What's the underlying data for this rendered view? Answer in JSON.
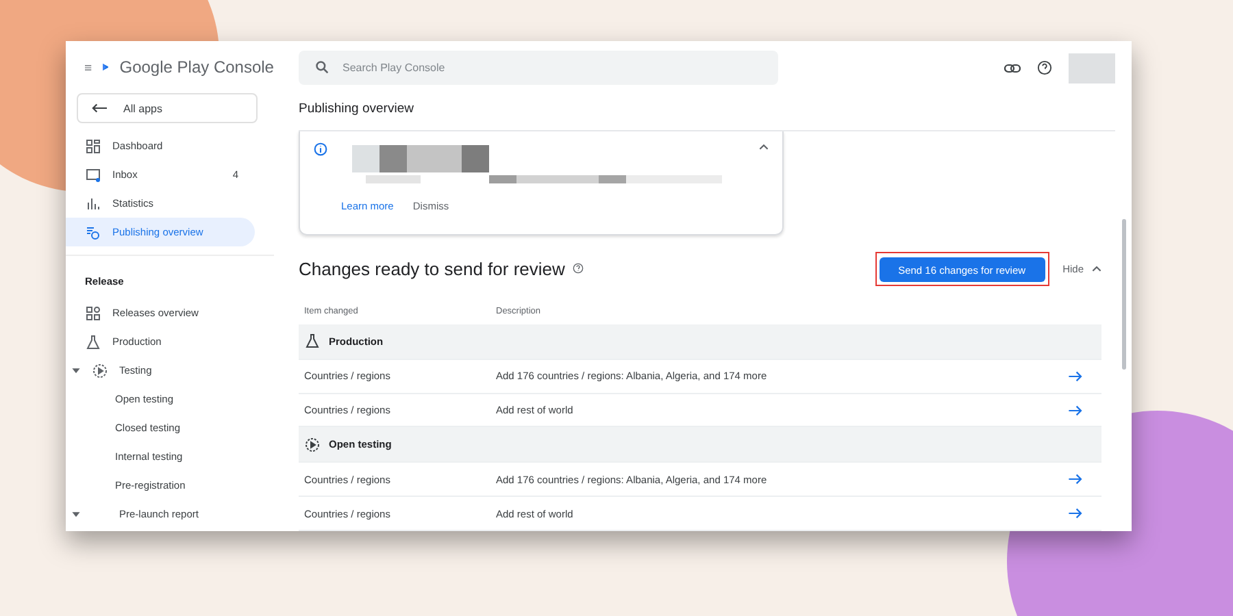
{
  "header": {
    "product": "Google Play Console",
    "search": {
      "placeholder": "Search Play Console"
    }
  },
  "sidebar": {
    "back": "All apps",
    "items": [
      {
        "label": "Dashboard",
        "selected": false
      },
      {
        "label": "Inbox",
        "badge": "4",
        "selected": false
      },
      {
        "label": "Statistics",
        "selected": false
      },
      {
        "label": "Publishing overview",
        "selected": true
      }
    ],
    "section": "Release",
    "release_items": [
      {
        "label": "Releases overview",
        "selected": false
      },
      {
        "label": "Production",
        "selected": false
      },
      {
        "label": "Testing",
        "selected": false,
        "expanded": true,
        "children": [
          {
            "label": "Open testing",
            "selected": false
          },
          {
            "label": "Closed testing",
            "selected": false
          },
          {
            "label": "Internal testing",
            "selected": false
          },
          {
            "label": "Pre-registration",
            "selected": false
          }
        ]
      },
      {
        "label": "Pre-launch report",
        "selected": false,
        "expanded": true
      }
    ]
  },
  "page_title": "Publishing overview",
  "notice": {
    "actions": [
      "Learn more",
      "Dismiss"
    ]
  },
  "changes": {
    "title": "Changes ready to send for review",
    "send_button": "Send 16 changes for review",
    "hide": "Hide",
    "columns": [
      "Item changed",
      "Description"
    ],
    "rows": [
      {
        "kind": "group",
        "label": "Production"
      },
      {
        "kind": "change",
        "item": "Countries / regions",
        "description": "Add 176 countries / regions: Albania, Algeria, and 174 more"
      },
      {
        "kind": "change",
        "item": "Countries / regions",
        "description": "Add rest of world"
      },
      {
        "kind": "group",
        "label": "Open testing"
      },
      {
        "kind": "change",
        "item": "Countries / regions",
        "description": "Add 176 countries / regions: Albania, Algeria, and 174 more"
      },
      {
        "kind": "change",
        "item": "Countries / regions",
        "description": "Add rest of world"
      }
    ]
  }
}
